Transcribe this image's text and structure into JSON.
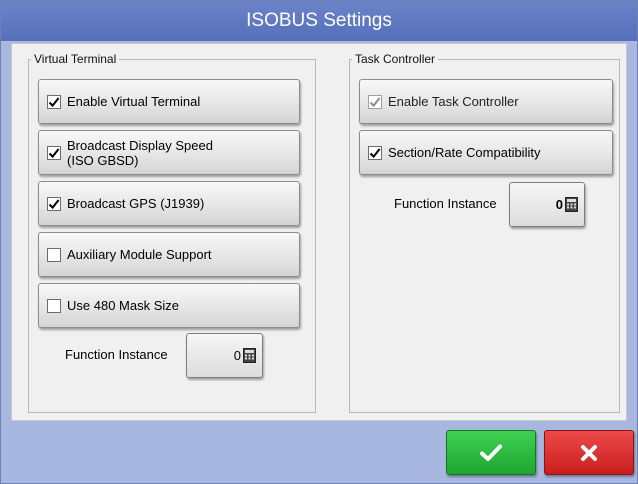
{
  "window": {
    "title": "ISOBUS Settings"
  },
  "virtual_terminal": {
    "title": "Virtual Terminal",
    "options": [
      {
        "label": "Enable Virtual Terminal",
        "checked": true
      },
      {
        "label": "Broadcast Display Speed\n(ISO GBSD)",
        "checked": true
      },
      {
        "label": "Broadcast GPS (J1939)",
        "checked": true
      },
      {
        "label": "Auxiliary Module Support",
        "checked": false
      },
      {
        "label": "Use 480 Mask Size",
        "checked": false
      }
    ],
    "function_instance": {
      "label": "Function Instance",
      "value": "0"
    }
  },
  "task_controller": {
    "title": "Task Controller",
    "options": [
      {
        "label": "Enable Task Controller",
        "checked": true,
        "disabled": true
      },
      {
        "label": "Section/Rate Compatibility",
        "checked": true,
        "disabled": false
      }
    ],
    "function_instance": {
      "label": "Function Instance",
      "value": "0"
    }
  },
  "actions": {
    "ok_icon": "checkmark-icon",
    "cancel_icon": "x-icon",
    "ok_color": "#2ebd40",
    "cancel_color": "#d92b2b"
  }
}
